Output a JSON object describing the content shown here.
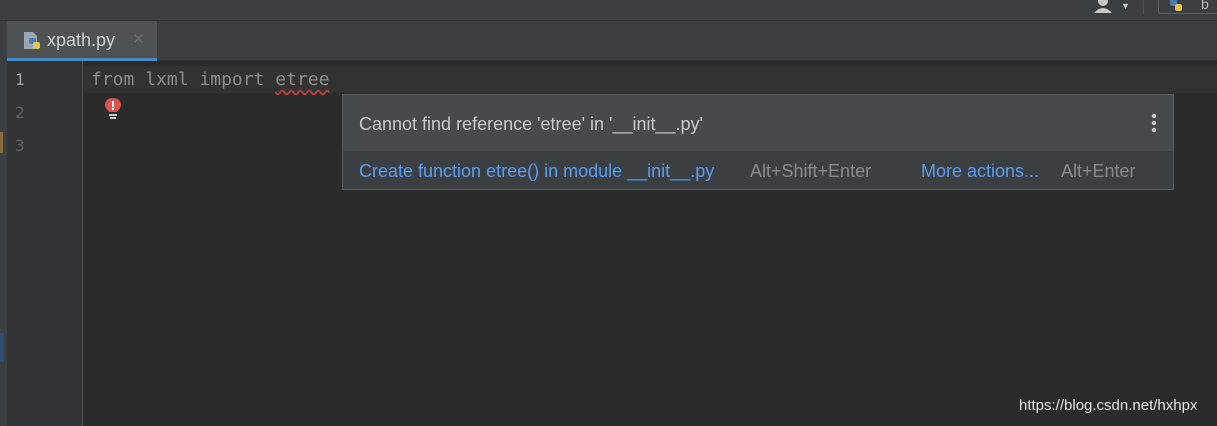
{
  "toolbar": {
    "icons": [
      "user-icon",
      "chevron-down-icon",
      "python-icon"
    ],
    "run_config_label": "b"
  },
  "tab": {
    "file_name": "xpath.py",
    "close_glyph": "×",
    "icon": "python-file-icon",
    "accent_color": "#4a88c7"
  },
  "editor": {
    "line_numbers": [
      "1",
      "2",
      "3"
    ],
    "code_line_1": {
      "kw_from": "from",
      "module": "lxml",
      "kw_import": "import",
      "name": "etree"
    },
    "error_underline_color": "#bc3f3c",
    "bulb_icon": "error-bulb-icon"
  },
  "popup": {
    "message": "Cannot find reference 'etree' in '__init__.py'",
    "menu_icon": "more-vertical-icon",
    "action_primary": "Create function etree() in module __init__.py",
    "action_primary_shortcut": "Alt+Shift+Enter",
    "action_more": "More actions...",
    "action_more_shortcut": "Alt+Enter",
    "link_color": "#589df6"
  },
  "watermark": "https://blog.csdn.net/hxhpx"
}
